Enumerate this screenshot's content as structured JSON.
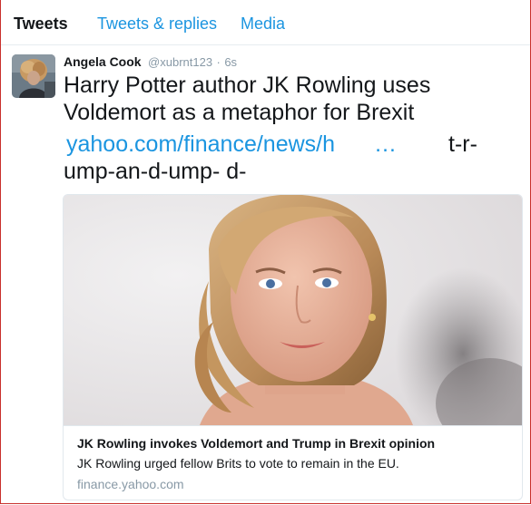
{
  "tabs": [
    {
      "label": "Tweets"
    },
    {
      "label": "Tweets & replies"
    },
    {
      "label": "Media"
    }
  ],
  "tweet": {
    "author_name": "Angela Cook",
    "author_handle": "@xubrnt123",
    "separator": "·",
    "time": "6s",
    "text_line1": "Harry Potter author JK Rowling uses",
    "text_line2": "Voldemort as a metaphor for Brexit",
    "link_visible": "yahoo.com/finance/news/h",
    "link_ellipsis": "…",
    "link_trailing": "t-r-",
    "link_wrap": "ump-an-d-ump- d-"
  },
  "card": {
    "title": "JK Rowling invokes Voldemort and Trump in Brexit opinion",
    "description": "JK Rowling urged fellow Brits to vote to remain in the EU.",
    "domain": "finance.yahoo.com"
  },
  "colors": {
    "link": "#1b95e0",
    "text": "#14171a",
    "muted": "#8899a6",
    "border": "#e1e8ed",
    "frame_border": "#c9302c"
  }
}
